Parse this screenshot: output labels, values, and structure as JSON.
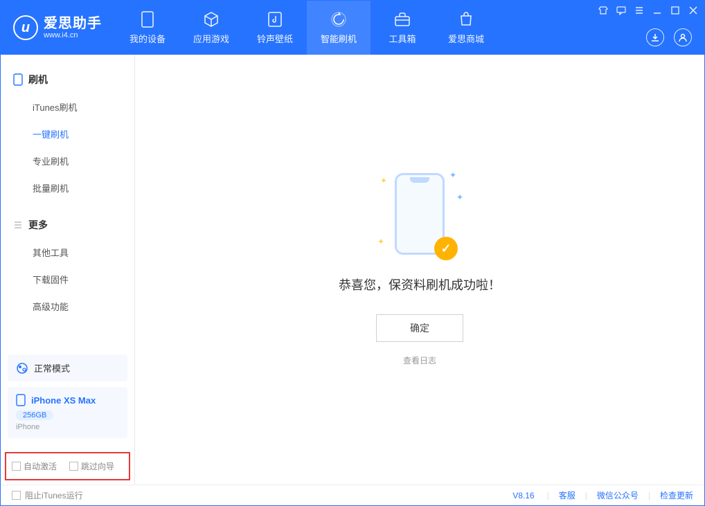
{
  "app": {
    "name": "爱思助手",
    "url": "www.i4.cn"
  },
  "nav": [
    {
      "label": "我的设备",
      "icon": "device"
    },
    {
      "label": "应用游戏",
      "icon": "cube"
    },
    {
      "label": "铃声壁纸",
      "icon": "music"
    },
    {
      "label": "智能刷机",
      "icon": "refresh",
      "active": true
    },
    {
      "label": "工具箱",
      "icon": "toolbox"
    },
    {
      "label": "爱思商城",
      "icon": "shop"
    }
  ],
  "sidebar": {
    "group1": {
      "title": "刷机",
      "items": [
        "iTunes刷机",
        "一键刷机",
        "专业刷机",
        "批量刷机"
      ],
      "activeIndex": 1
    },
    "group2": {
      "title": "更多",
      "items": [
        "其他工具",
        "下载固件",
        "高级功能"
      ]
    }
  },
  "device": {
    "mode_label": "正常模式",
    "name": "iPhone XS Max",
    "storage": "256GB",
    "type": "iPhone"
  },
  "options": {
    "auto_activate": "自动激活",
    "skip_guide": "跳过向导"
  },
  "result": {
    "message": "恭喜您，保资料刷机成功啦！",
    "ok_button": "确定",
    "log_link": "查看日志"
  },
  "status": {
    "block_itunes": "阻止iTunes运行",
    "version": "V8.16",
    "links": [
      "客服",
      "微信公众号",
      "检查更新"
    ]
  }
}
